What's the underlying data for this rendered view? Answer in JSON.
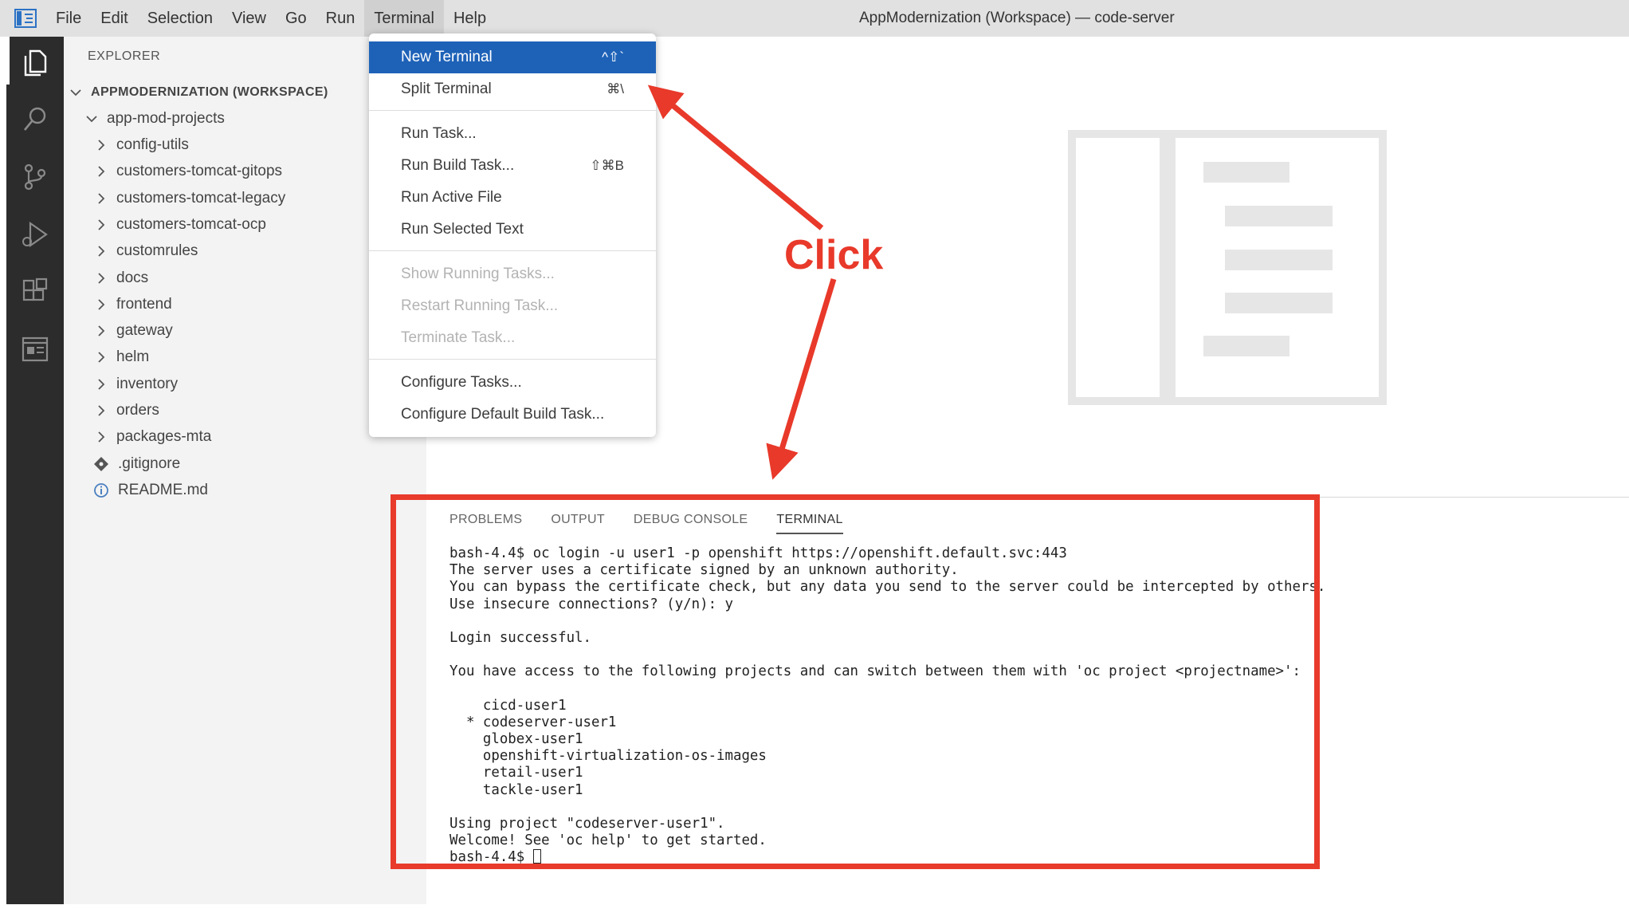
{
  "window": {
    "title": "AppModernization (Workspace) — code-server"
  },
  "menubar": {
    "items": [
      {
        "label": "File"
      },
      {
        "label": "Edit"
      },
      {
        "label": "Selection"
      },
      {
        "label": "View"
      },
      {
        "label": "Go"
      },
      {
        "label": "Run"
      },
      {
        "label": "Terminal",
        "active": true
      },
      {
        "label": "Help"
      }
    ]
  },
  "activitybar": {
    "icons": [
      "files-icon",
      "search-icon",
      "source-control-icon",
      "run-debug-icon",
      "extensions-icon",
      "remote-explorer-icon"
    ]
  },
  "explorer": {
    "title": "EXPLORER",
    "workspace": "APPMODERNIZATION (WORKSPACE)",
    "root_folder": "app-mod-projects",
    "folders": [
      "config-utils",
      "customers-tomcat-gitops",
      "customers-tomcat-legacy",
      "customers-tomcat-ocp",
      "customrules",
      "docs",
      "frontend",
      "gateway",
      "helm",
      "inventory",
      "orders",
      "packages-mta"
    ],
    "files": [
      {
        "name": ".gitignore",
        "icon": "git-icon"
      },
      {
        "name": "README.md",
        "icon": "info-icon"
      }
    ]
  },
  "terminal_menu": {
    "items": [
      {
        "label": "New Terminal",
        "shortcut": "^⇧`",
        "state": "selected"
      },
      {
        "label": "Split Terminal",
        "shortcut": "⌘\\",
        "state": "normal"
      },
      {
        "label": "Run Task...",
        "shortcut": "",
        "state": "normal"
      },
      {
        "label": "Run Build Task...",
        "shortcut": "⇧⌘B",
        "state": "normal"
      },
      {
        "label": "Run Active File",
        "shortcut": "",
        "state": "normal"
      },
      {
        "label": "Run Selected Text",
        "shortcut": "",
        "state": "normal"
      },
      {
        "label": "Show Running Tasks...",
        "shortcut": "",
        "state": "disabled"
      },
      {
        "label": "Restart Running Task...",
        "shortcut": "",
        "state": "disabled"
      },
      {
        "label": "Terminate Task...",
        "shortcut": "",
        "state": "disabled"
      },
      {
        "label": "Configure Tasks...",
        "shortcut": "",
        "state": "normal"
      },
      {
        "label": "Configure Default Build Task...",
        "shortcut": "",
        "state": "normal"
      }
    ]
  },
  "panel": {
    "tabs": [
      {
        "label": "PROBLEMS",
        "active": false
      },
      {
        "label": "OUTPUT",
        "active": false
      },
      {
        "label": "DEBUG CONSOLE",
        "active": false
      },
      {
        "label": "TERMINAL",
        "active": true
      }
    ]
  },
  "terminal": {
    "lines": [
      "bash-4.4$ oc login -u user1 -p openshift https://openshift.default.svc:443",
      "The server uses a certificate signed by an unknown authority.",
      "You can bypass the certificate check, but any data you send to the server could be intercepted by others.",
      "Use insecure connections? (y/n): y",
      "",
      "Login successful.",
      "",
      "You have access to the following projects and can switch between them with 'oc project <projectname>':",
      "",
      "    cicd-user1",
      "  * codeserver-user1",
      "    globex-user1",
      "    openshift-virtualization-os-images",
      "    retail-user1",
      "    tackle-user1",
      "",
      "Using project \"codeserver-user1\".",
      "Welcome! See 'oc help' to get started.",
      "bash-4.4$ "
    ]
  },
  "annotation": {
    "label": "Click",
    "color": "#e8392a"
  }
}
